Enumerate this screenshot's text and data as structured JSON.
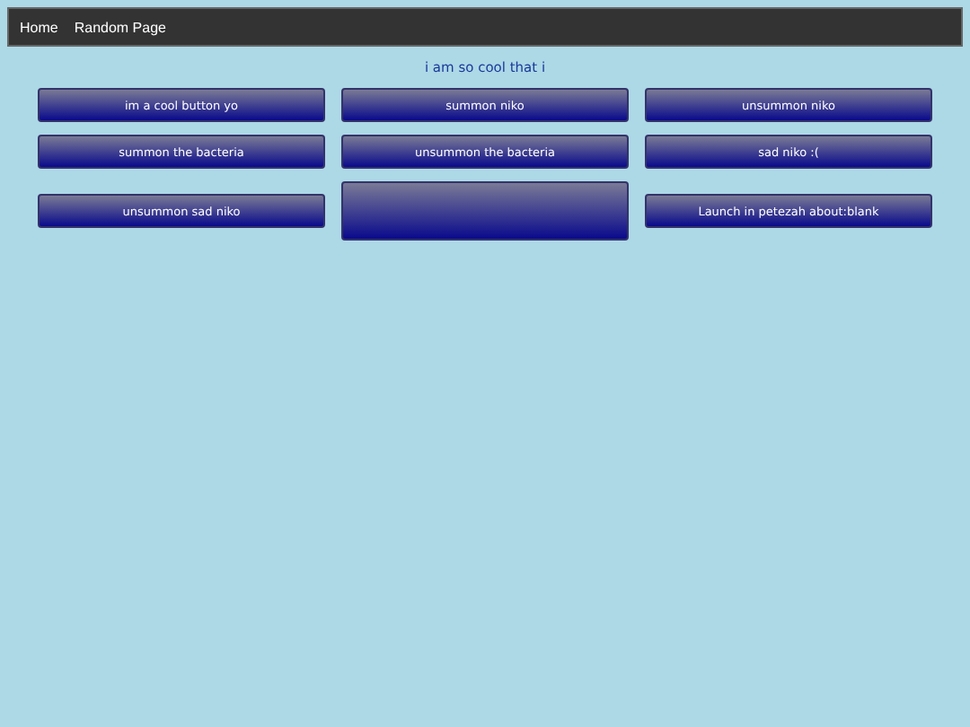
{
  "nav": {
    "links": [
      "Home",
      "Random Page"
    ]
  },
  "heading": "i am so cool that i",
  "buttons": [
    {
      "kind": "text",
      "label": "im a cool button yo"
    },
    {
      "kind": "text",
      "label": "summon niko"
    },
    {
      "kind": "text",
      "label": "unsummon niko"
    },
    {
      "kind": "text",
      "label": "summon the bacteria"
    },
    {
      "kind": "text",
      "label": "unsummon the bacteria"
    },
    {
      "kind": "text",
      "label": "sad niko :("
    },
    {
      "kind": "text",
      "label": "unsummon sad niko"
    },
    {
      "kind": "blank"
    },
    {
      "kind": "text",
      "label": "Launch in petezah about:blank"
    }
  ]
}
